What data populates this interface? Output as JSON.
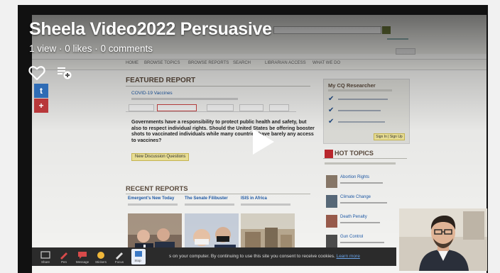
{
  "video": {
    "title": "Sheela Video2022 Persuasive",
    "meta": "1 view · 0 likes · 0 comments"
  },
  "sidebar_icons": [
    "heart-icon",
    "add-to-queue-icon",
    "twitter-icon",
    "google-plus-icon"
  ],
  "colors": {
    "player_bg": "#111111",
    "twitter": "#2f6cb5",
    "google_plus": "#b8383a",
    "accent_yellow": "#f2e79a",
    "feedback_tab": "#f0b73a"
  },
  "screen_share": {
    "search_label": "SEARCH",
    "featured_heading": "FEATURED REPORT",
    "featured_link": "COVID-19 Vaccines",
    "question_text": "Governments have a responsibility to protect public health and safety, but also to respect individual rights. Should the United States be offering booster shots to vaccinated individuals while many countries have barely any access to vaccines?",
    "new_discussion": "New Discussion Questions",
    "recent_heading": "RECENT REPORTS",
    "recent_titles": [
      "Emergent's New Today",
      "The Senate Filibuster",
      "ISIS in Africa"
    ],
    "researcher_heading": "My CQ Researcher",
    "signin": "Sign In  |  Sign Up",
    "hot_topics_heading": "HOT TOPICS",
    "hot_topics": [
      "Abortion Rights",
      "Climate Change",
      "Death Penalty",
      "Gun Control"
    ],
    "cookie_text": "s on your computer. By continuing to use this site you consent to receive cookies.",
    "cookie_link": "Learn more"
  },
  "toolbar": {
    "labels": [
      "Share",
      "Pen",
      "Message",
      "Stickers",
      "Focus",
      "Stop"
    ]
  }
}
